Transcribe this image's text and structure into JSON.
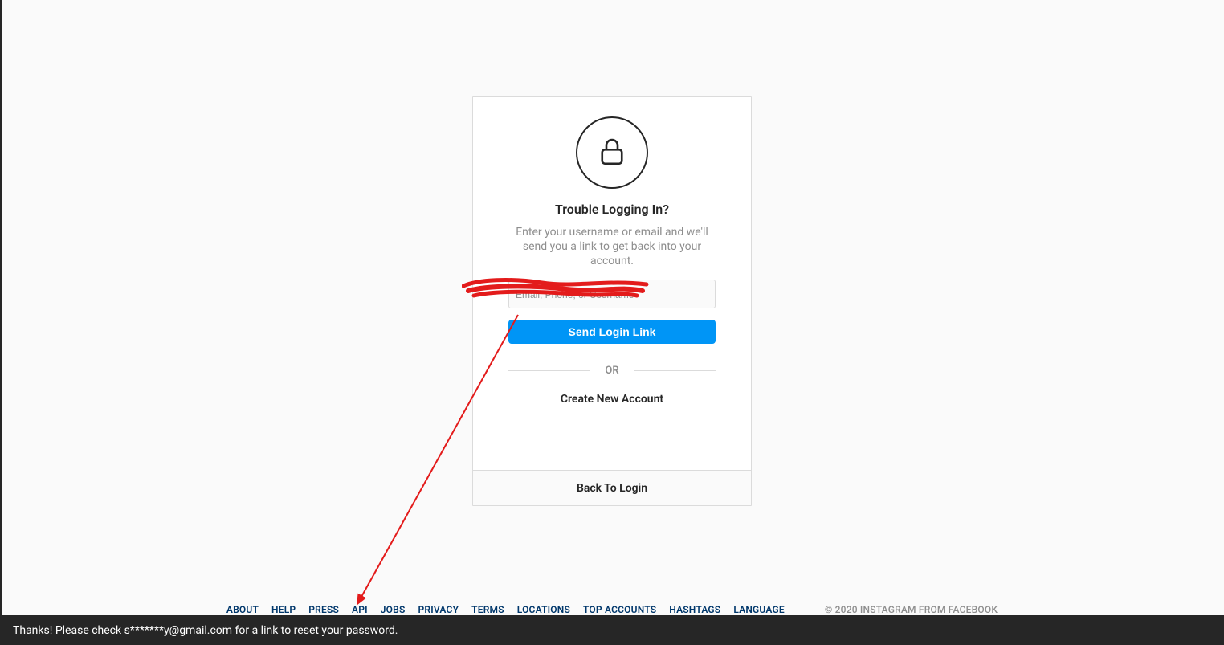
{
  "card": {
    "title": "Trouble Logging In?",
    "subtitle": "Enter your username or email and we'll send you a link to get back into your account.",
    "input_placeholder": "Email, Phone, or Username",
    "send_button": "Send Login Link",
    "or_label": "OR",
    "create_account": "Create New Account",
    "back_to_login": "Back To Login"
  },
  "footer": {
    "links": {
      "about": "ABOUT",
      "help": "HELP",
      "press": "PRESS",
      "api": "API",
      "jobs": "JOBS",
      "privacy": "PRIVACY",
      "terms": "TERMS",
      "locations": "LOCATIONS",
      "top_accounts": "TOP ACCOUNTS",
      "hashtags": "HASHTAGS",
      "language": "LANGUAGE"
    },
    "copyright": "© 2020 INSTAGRAM FROM FACEBOOK"
  },
  "toast": {
    "message": "Thanks! Please check s*******y@gmail.com for a link to reset your password."
  }
}
